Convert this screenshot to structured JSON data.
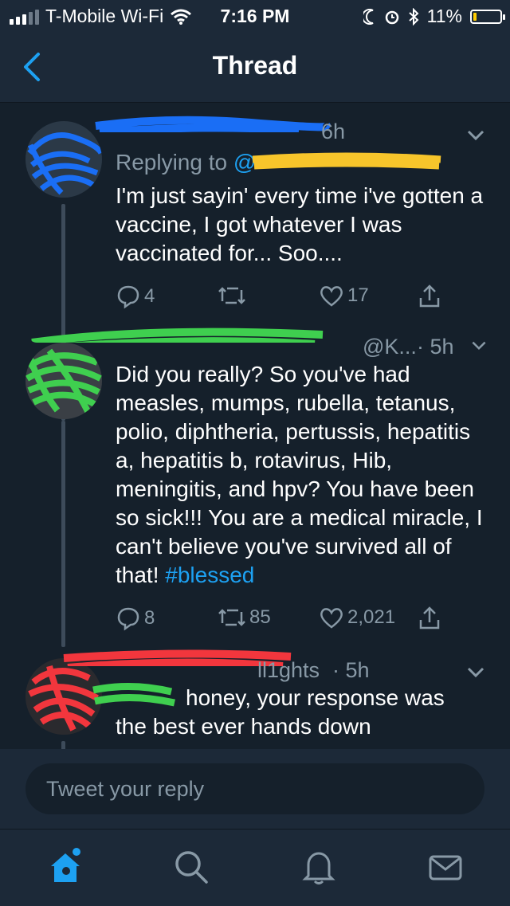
{
  "status_bar": {
    "carrier": "T-Mobile Wi-Fi",
    "time": "7:16 PM",
    "battery": "11%",
    "battery_level": 0.11
  },
  "nav": {
    "title": "Thread",
    "back_icon": "chevron-left-icon"
  },
  "tweets": [
    {
      "time": "6h",
      "replying_to_label": "Replying to",
      "replying_to_handle": "@",
      "body": "I'm just sayin' every time i've gotten a vaccine, I got whatever I was vaccinated for... Soo....",
      "replies": "4",
      "retweets": "",
      "likes": "17"
    },
    {
      "handle_fragment": "@K...",
      "time": "· 5h",
      "body": "Did you really? So you've had measles, mumps, rubella, tetanus, polio, diphtheria, pertussis, hepatitis a, hepatitis b, rotavirus, Hib, meningitis, and hpv? You have been so sick!!! You are a medical miracle, I can't believe you've survived all of that!",
      "hashtag": "#blessed",
      "replies": "8",
      "retweets": "85",
      "likes": "2,021"
    },
    {
      "handle_fragment": "ll1ghts",
      "time": "· 5h",
      "body_line1": "honey, your response was",
      "body_line2": "the best ever hands down"
    }
  ],
  "reply_placeholder": "Tweet your reply",
  "colors": {
    "background": "#15202b",
    "bar": "#1c2938",
    "accent": "#1da1f2",
    "muted": "#8899a6",
    "scribble_blue": "#1a6ef5",
    "scribble_yellow": "#f7c52b",
    "scribble_green": "#3fcf4f",
    "scribble_red": "#f2363d"
  },
  "tab_icons": [
    "home-icon",
    "search-icon",
    "notifications-icon",
    "messages-icon"
  ]
}
